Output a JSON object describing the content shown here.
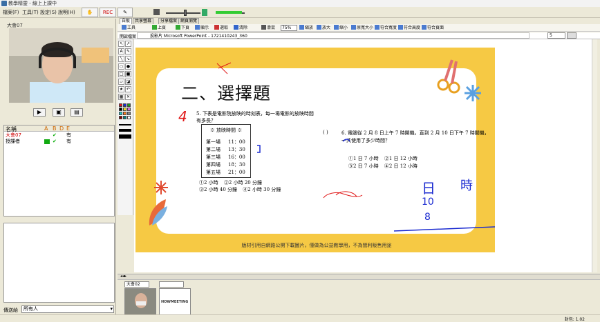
{
  "window": {
    "title": "教學精靈 - 線上上課中"
  },
  "menu": [
    "檔案(F)",
    "工具(T)",
    "設定(S)",
    "說明(H)"
  ],
  "toolbar": {
    "rec_label": "REC"
  },
  "left_panel": {
    "video_title": "大會07",
    "userlist_headers": [
      "名稱",
      "A",
      "B",
      "D",
      "E"
    ],
    "users": [
      {
        "name": "大會07",
        "status": "有",
        "color": "#d00000"
      },
      {
        "name": "授課者",
        "status": "有",
        "color": "#000000"
      }
    ],
    "chat_target_label": "傳送給",
    "chat_target_value": "所有人"
  },
  "tabs": [
    "白板",
    "共享螢幕",
    "分享檔案",
    "網頁瀏覽"
  ],
  "content_toolbar": {
    "items": [
      "工具",
      "上頁",
      "下頁",
      "顯示",
      "選取",
      "清除",
      "滑鼠",
      "縮放",
      "放大",
      "縮小",
      "原寬大小",
      "符合寬度",
      "符合高度",
      "符合頁面"
    ],
    "zoom": "75%",
    "address_label": "開啟檔案",
    "address_value": "投影片 Microsoft PowerPoint - 1721410243_360",
    "page_value": "5"
  },
  "slide": {
    "title": "二、選擇題",
    "q5_text": "5. 下表是電影院放映的時刻表，每一場電影的放映時間有多長？",
    "schedule_title": "※ 放映時間 ※",
    "schedule": [
      {
        "label": "第一場",
        "time": "11：00"
      },
      {
        "label": "第二場",
        "time": "13：30"
      },
      {
        "label": "第三場",
        "time": "16：00"
      },
      {
        "label": "第四場",
        "time": "18：30"
      },
      {
        "label": "第五場",
        "time": "21：00"
      }
    ],
    "q5_options": [
      "①2 小時",
      "②2 小時 20 分鐘",
      "③2 小時 40 分鐘",
      "④2 小時 30 分鐘"
    ],
    "q6_paren": "(      )",
    "q6_text": "6. 電腦從 2 月 8 日上午 7 時開機，直到 2 月 10 日下午 7 時關機，一共使用了多少時間？",
    "q6_options": [
      "①1 日 7 小時",
      "②1 日 12 小時",
      "③2 日 7 小時",
      "④2 日 12 小時"
    ],
    "footer": "版材引用自網路公開下載圖片，僅做為公益教學用，不為營利販售用途",
    "handwriting": [
      "4",
      "日",
      "時",
      "10",
      "8"
    ]
  },
  "bottom": {
    "thumb_select": "大會02",
    "logo_text": "HOWMEETING"
  },
  "status": {
    "right_text": "封包: 1.02"
  },
  "colors": {
    "slide_yellow": "#f6c944",
    "ink_red": "#e01818",
    "ink_blue": "#1a2ad0"
  }
}
